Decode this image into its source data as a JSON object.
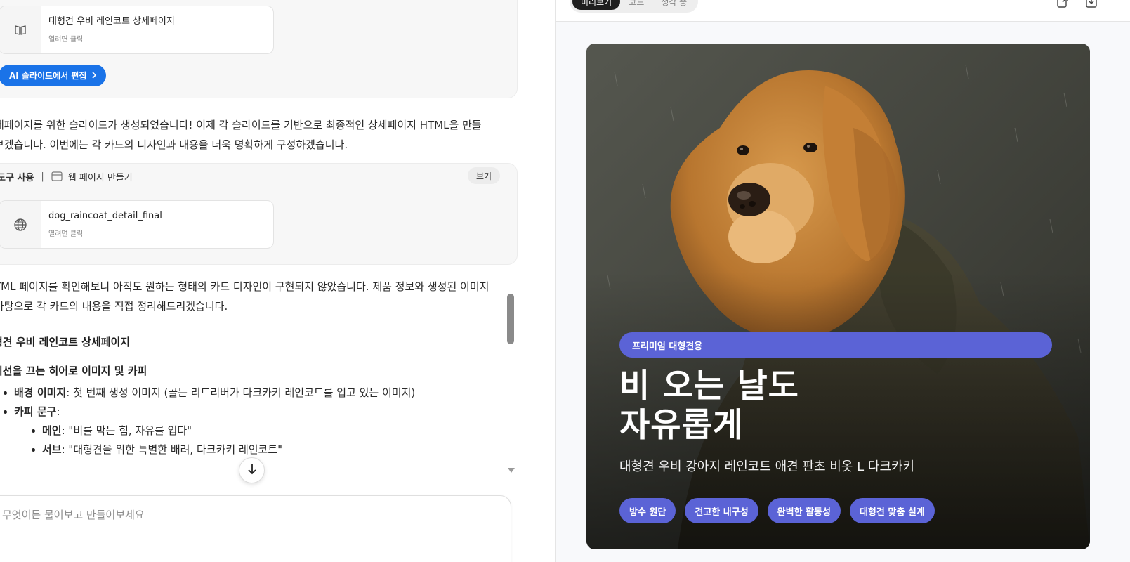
{
  "chat": {
    "file_card_1": {
      "title": "대형견 우비 레인코트 상세페이지",
      "subtitle": "열려면 클릭"
    },
    "ai_edit_button": "AI 슬라이드에서 편집",
    "message_1_line1": "세페이지를 위한 슬라이드가 생성되었습니다! 이제 각 슬라이드를 기반으로 최종적인 상세페이지 HTML을 만들",
    "message_1_line2": "보겠습니다. 이번에는 각 카드의 디자인과 내용을 더욱 명확하게 구성하겠습니다.",
    "tool_use": {
      "label": "도구 사용",
      "separator": "|",
      "tool_name": "웹 페이지 만들기",
      "view_button": "보기"
    },
    "file_card_2": {
      "title": "dog_raincoat_detail_final",
      "subtitle": "열려면 클릭"
    },
    "message_2_line1": "TML 페이지를 확인해보니 아직도 원하는 형태의 카드 디자인이 구현되지 않았습니다. 제품 정보와 생성된 이미지",
    "message_2_line2": "바탕으로 각 카드의 내용을 직접 정리해드리겠습니다.",
    "heading_1": "형견 우비 레인코트 상세페이지",
    "heading_2": "시선을 끄는 히어로 이미지 및 카피",
    "bullets": [
      {
        "bold": "배경 이미지",
        "text": ": 첫 번째 생성 이미지 (골든 리트리버가 다크카키 레인코트를 입고 있는 이미지)"
      },
      {
        "bold": "카피 문구",
        "text": ":"
      }
    ],
    "sub_bullets": [
      {
        "bold": "메인",
        "text": ": \"비를 막는 힘, 자유를 입다\""
      },
      {
        "bold": "서브",
        "text": ": \"대형견을 위한 특별한 배려, 다크카키 레인코트\""
      }
    ],
    "input_placeholder": "무엇이든 물어보고 만들어보세요"
  },
  "preview": {
    "tabs": [
      "미리보기",
      "코드",
      "생각 중"
    ],
    "active_tab": "미리보기",
    "hero": {
      "badge": "프리미엄 대형견용",
      "title_line1": "비 오는 날도",
      "title_line2": "자유롭게",
      "subtitle": "대형견 우비 강아지 레인코트 애견 판초 비옷 L 다크카키",
      "features": [
        "방수 원단",
        "견고한 내구성",
        "완벽한 활동성",
        "대형견 맞춤 설계"
      ]
    }
  },
  "colors": {
    "accent_blue": "#1a73e8",
    "badge_purple": "#5b63d6",
    "coat_khaki": "#3d3a2c",
    "fur_gold": "#c98a3c"
  }
}
